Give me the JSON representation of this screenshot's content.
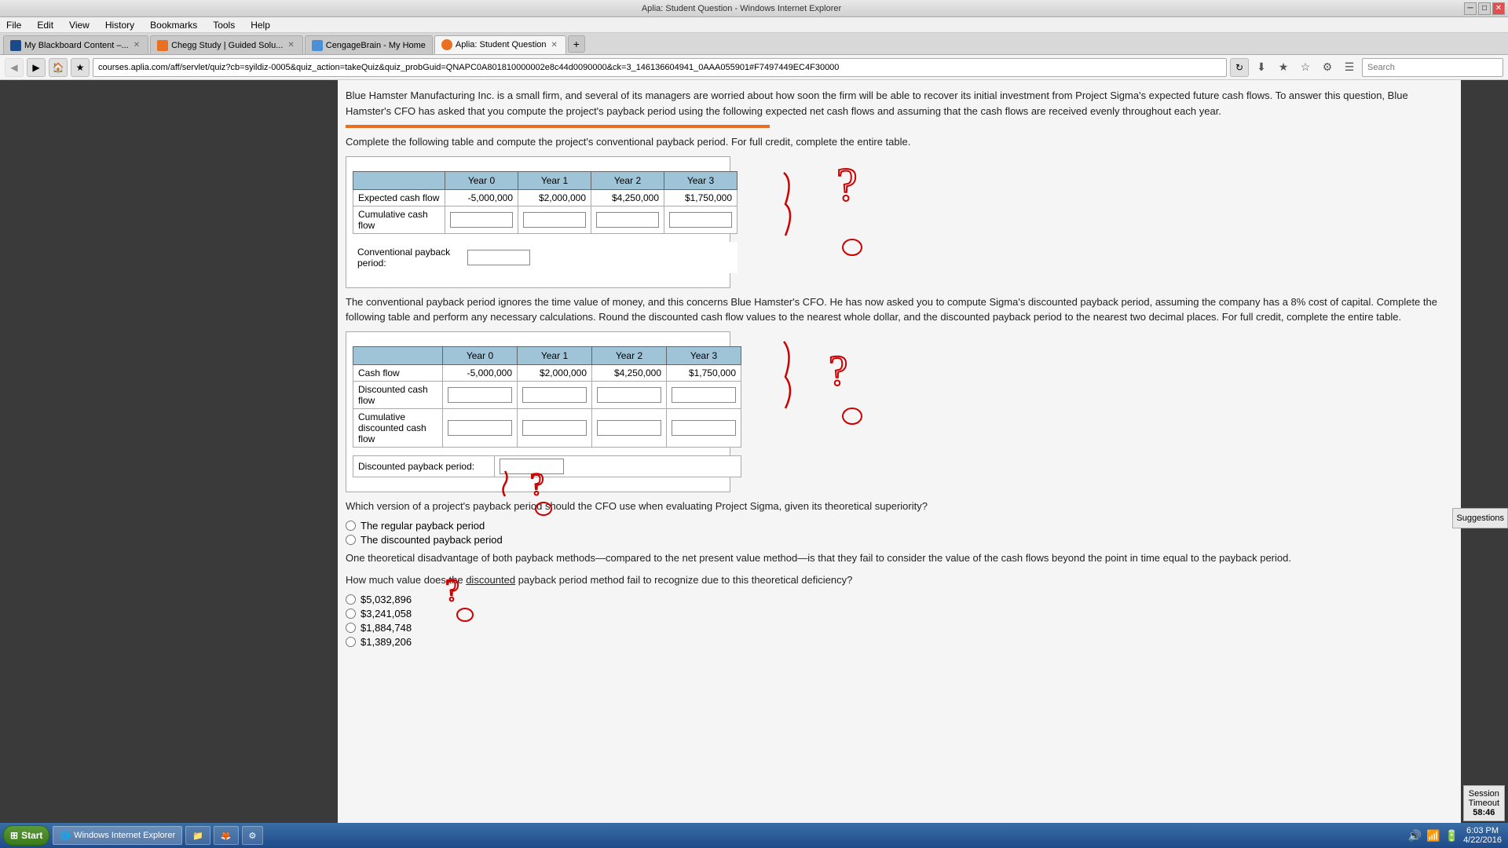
{
  "titlebar": {
    "text": "Aplia: Student Question - Windows Internet Explorer"
  },
  "menubar": {
    "items": [
      "File",
      "Edit",
      "View",
      "History",
      "Bookmarks",
      "Tools",
      "Help"
    ]
  },
  "tabs": [
    {
      "label": "My Blackboard Content –...",
      "favicon": "bb",
      "active": false,
      "closable": true
    },
    {
      "label": "Chegg Study | Guided Solu...",
      "favicon": "chegg",
      "active": false,
      "closable": true
    },
    {
      "label": "CengageBrain - My Home",
      "favicon": "cg",
      "active": false,
      "closable": false
    },
    {
      "label": "Aplia: Student Question",
      "favicon": "aplia",
      "active": true,
      "closable": true
    }
  ],
  "addressbar": {
    "url": "courses.aplia.com/aff/servlet/quiz?cb=syildiz-0005&quiz_action=takeQuiz&quiz_probGuid=QNAPC0A801810000002e8c44d0090000&ck=3_146136604941_0AAA055901#F7497449EC4F30000",
    "search_placeholder": "Search"
  },
  "content": {
    "intro_text": "Blue Hamster Manufacturing Inc. is a small firm, and several of its managers are worried about how soon the firm will be able to recover its initial investment from Project Sigma's expected future cash flows. To answer this question, Blue Hamster's CFO has asked that you compute the project's payback period using the following expected net cash flows and assuming that the cash flows are received evenly throughout each year.",
    "table1_instruction": "Complete the following table and compute the project's conventional payback period. For full credit, complete the entire table.",
    "table1": {
      "headers": [
        "",
        "Year 0",
        "Year 1",
        "Year 2",
        "Year 3"
      ],
      "rows": [
        {
          "label": "Expected cash flow",
          "values": [
            "-5,000,000",
            "$2,000,000",
            "$4,250,000",
            "$1,750,000"
          ]
        },
        {
          "label": "Cumulative cash flow",
          "values": [
            "",
            "",
            "",
            ""
          ]
        }
      ],
      "payback_label": "Conventional payback period:"
    },
    "discounted_text": "The conventional payback period ignores the time value of money, and this concerns Blue Hamster's CFO. He has now asked you to compute Sigma's discounted payback period, assuming the company has a 8% cost of capital. Complete the following table and perform any necessary calculations. Round the discounted cash flow values to the nearest whole dollar, and the discounted payback period to the nearest two decimal places. For full credit, complete the entire table.",
    "table2": {
      "headers": [
        "",
        "Year 0",
        "Year 1",
        "Year 2",
        "Year 3"
      ],
      "rows": [
        {
          "label": "Cash flow",
          "values": [
            "-5,000,000",
            "$2,000,000",
            "$4,250,000",
            "$1,750,000"
          ]
        },
        {
          "label": "Discounted cash flow",
          "values": [
            "",
            "",
            "",
            ""
          ]
        },
        {
          "label": "Cumulative discounted cash flow",
          "values": [
            "",
            "",
            "",
            ""
          ]
        }
      ],
      "payback_label": "Discounted payback period:"
    },
    "version_question": "Which version of a project's payback period should the CFO use when evaluating Project Sigma, given its theoretical superiority?",
    "radio_options": [
      "The regular payback period",
      "The discounted payback period"
    ],
    "disadvantage_text": "One theoretical disadvantage of both payback methods—compared to the net present value method—is that they fail to consider the value of the cash flows beyond the point in time equal to the payback period.",
    "value_question": "How much value does the discounted payback period method fail to recognize due to this theoretical deficiency?",
    "answer_options": [
      "$5,032,896",
      "$3,241,058",
      "$1,884,748",
      "$1,389,206"
    ]
  },
  "session_timeout": {
    "label": "Session\nTimeout",
    "time": "58:46"
  },
  "taskbar": {
    "start_label": "Start",
    "apps": [
      {
        "label": "Windows Internet Explorer",
        "icon": "🌐",
        "active": true
      },
      {
        "label": "Windows Explorer",
        "icon": "📁",
        "active": false
      },
      {
        "label": "Mozilla Firefox",
        "icon": "🦊",
        "active": false
      },
      {
        "label": "Utilities",
        "icon": "⚙",
        "active": false
      }
    ],
    "time": "6:03 PM",
    "date": "4/22/2016"
  },
  "suggestions_btn": "Suggestions"
}
